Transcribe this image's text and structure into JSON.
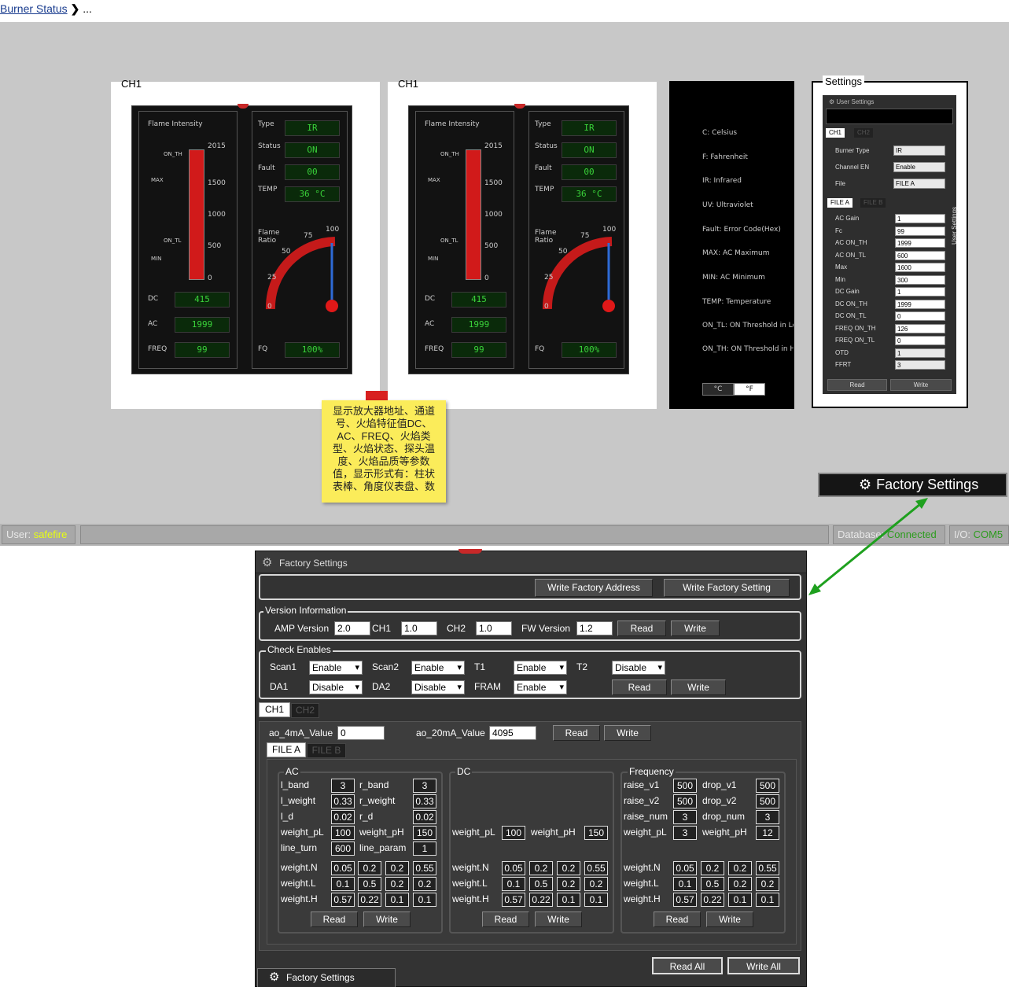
{
  "breadcrumb": {
    "link": "Burner Status",
    "separator": "❯",
    "ellipsis": "..."
  },
  "gauges": [
    {
      "title": "CH1",
      "flame_intensity_label": "Flame Intensity",
      "scale": [
        "2015",
        "1500",
        "1000",
        "500",
        "0"
      ],
      "markers": [
        "ON_TH",
        "MAX",
        "ON_TL",
        "MIN"
      ],
      "type_label": "Type",
      "type_value": "IR",
      "status_label": "Status",
      "status_value": "ON",
      "fault_label": "Fault",
      "fault_value": "00",
      "temp_label": "TEMP",
      "temp_value": "36 °C",
      "flame_ratio_label": "Flame Ratio",
      "ratio_ticks": [
        "0",
        "25",
        "50",
        "75",
        "100"
      ],
      "dc_label": "DC",
      "dc_value": "415",
      "ac_label": "AC",
      "ac_value": "1999",
      "freq_label": "FREQ",
      "freq_value": "99",
      "fq_label": "FQ",
      "fq_value": "100%"
    },
    {
      "title": "CH1",
      "flame_intensity_label": "Flame Intensity",
      "scale": [
        "2015",
        "1500",
        "1000",
        "500",
        "0"
      ],
      "markers": [
        "ON_TH",
        "MAX",
        "ON_TL",
        "MIN"
      ],
      "type_label": "Type",
      "type_value": "IR",
      "status_label": "Status",
      "status_value": "ON",
      "fault_label": "Fault",
      "fault_value": "00",
      "temp_label": "TEMP",
      "temp_value": "36 °C",
      "flame_ratio_label": "Flame Ratio",
      "ratio_ticks": [
        "0",
        "25",
        "50",
        "75",
        "100"
      ],
      "dc_label": "DC",
      "dc_value": "415",
      "ac_label": "AC",
      "ac_value": "1999",
      "freq_label": "FREQ",
      "freq_value": "99",
      "fq_label": "FQ",
      "fq_value": "100%"
    }
  ],
  "legend": {
    "items": [
      "C: Celsius",
      "F: Fahrenheit",
      "IR: Infrared",
      "UV: Ultraviolet",
      "Fault: Error Code(Hex)",
      "MAX: AC Maximum",
      "MIN: AC Minimum",
      "TEMP: Temperature",
      "ON_TL: ON Threshold in Low",
      "ON_TH: ON Threshold in High"
    ],
    "unit_c": "°C",
    "unit_f": "°F"
  },
  "settings_panel": {
    "title": "Settings",
    "header": "User Settings",
    "side_label": "User Settings",
    "tabs": [
      "CH1",
      "CH2"
    ],
    "burner_type_label": "Burner Type",
    "burner_type_value": "IR",
    "channel_en_label": "Channel EN",
    "channel_en_value": "Enable",
    "file_label": "File",
    "file_value": "FILE A",
    "file_tabs": [
      "FILE A",
      "FILE B"
    ],
    "rows": [
      {
        "label": "AC Gain",
        "value": "1"
      },
      {
        "label": "Fc",
        "value": "99"
      },
      {
        "label": "AC ON_TH",
        "value": "1999"
      },
      {
        "label": "AC ON_TL",
        "value": "600"
      },
      {
        "label": "Max",
        "value": "1600"
      },
      {
        "label": "Min",
        "value": "300"
      },
      {
        "label": "DC Gain",
        "value": "1"
      },
      {
        "label": "DC ON_TH",
        "value": "1999"
      },
      {
        "label": "DC ON_TL",
        "value": "0"
      },
      {
        "label": "FREQ ON_TH",
        "value": "126"
      },
      {
        "label": "FREQ ON_TL",
        "value": "0"
      },
      {
        "label": "OTD",
        "value": "1"
      },
      {
        "label": "FFRT",
        "value": "3"
      }
    ],
    "read": "Read",
    "write": "Write"
  },
  "note": {
    "text": "显示放大器地址、通道号、火焰特征值DC、AC、FREQ、火焰类型、火焰状态、探头温度、火焰品质等参数值，显示形式有：柱状表棒、角度仪表盘、数"
  },
  "factory_chip": {
    "label": "Factory Settings"
  },
  "status_bar": {
    "user_label": "User:",
    "user_value": "safefire",
    "db_label": "Database:",
    "db_value": "Connected",
    "io_label": "I/O:",
    "io_value": "COM5"
  },
  "factory": {
    "title": "Factory Settings",
    "write_address": "Write Factory Address",
    "write_setting": "Write Factory Setting",
    "version": {
      "legend": "Version Information",
      "amp_label": "AMP Version",
      "amp_value": "2.0",
      "ch1_label": "CH1",
      "ch1_value": "1.0",
      "ch2_label": "CH2",
      "ch2_value": "1.0",
      "fw_label": "FW Version",
      "fw_value": "1.2",
      "read": "Read",
      "write": "Write"
    },
    "checks": {
      "legend": "Check Enables",
      "scan1_label": "Scan1",
      "scan1_value": "Enable",
      "scan2_label": "Scan2",
      "scan2_value": "Enable",
      "t1_label": "T1",
      "t1_value": "Enable",
      "t2_label": "T2",
      "t2_value": "Disable",
      "da1_label": "DA1",
      "da1_value": "Disable",
      "da2_label": "DA2",
      "da2_value": "Disable",
      "fram_label": "FRAM",
      "fram_value": "Enable",
      "read": "Read",
      "write": "Write"
    },
    "ch_tabs": [
      "CH1",
      "CH2"
    ],
    "ao4_label": "ao_4mA_Value",
    "ao4_value": "0",
    "ao20_label": "ao_20mA_Value",
    "ao20_value": "4095",
    "ao_read": "Read",
    "ao_write": "Write",
    "file_tabs": [
      "FILE A",
      "FILE B"
    ],
    "ac": {
      "legend": "AC",
      "l_band_label": "l_band",
      "l_band": "3",
      "r_band_label": "r_band",
      "r_band": "3",
      "l_weight_label": "l_weight",
      "l_weight": "0.33",
      "r_weight_label": "r_weight",
      "r_weight": "0.33",
      "l_d_label": "l_d",
      "l_d": "0.02",
      "r_d_label": "r_d",
      "r_d": "0.02",
      "weight_pl_label": "weight_pL",
      "weight_pl": "100",
      "weight_ph_label": "weight_pH",
      "weight_ph": "150",
      "line_turn_label": "line_turn",
      "line_turn": "600",
      "line_param_label": "line_param",
      "line_param": "1",
      "wn_label": "weight.N",
      "wn": [
        "0.05",
        "0.2",
        "0.2",
        "0.55"
      ],
      "wl_label": "weight.L",
      "wl": [
        "0.1",
        "0.5",
        "0.2",
        "0.2"
      ],
      "wh_label": "weight.H",
      "wh": [
        "0.57",
        "0.22",
        "0.1",
        "0.1"
      ],
      "read": "Read",
      "write": "Write"
    },
    "dc": {
      "legend": "DC",
      "weight_pl_label": "weight_pL",
      "weight_pl": "100",
      "weight_ph_label": "weight_pH",
      "weight_ph": "150",
      "wn_label": "weight.N",
      "wn": [
        "0.05",
        "0.2",
        "0.2",
        "0.55"
      ],
      "wl_label": "weight.L",
      "wl": [
        "0.1",
        "0.5",
        "0.2",
        "0.2"
      ],
      "wh_label": "weight.H",
      "wh": [
        "0.57",
        "0.22",
        "0.1",
        "0.1"
      ],
      "read": "Read",
      "write": "Write"
    },
    "freq": {
      "legend": "Frequency",
      "raise_v1_label": "raise_v1",
      "raise_v1": "500",
      "drop_v1_label": "drop_v1",
      "drop_v1": "500",
      "raise_v2_label": "raise_v2",
      "raise_v2": "500",
      "drop_v2_label": "drop_v2",
      "drop_v2": "500",
      "raise_num_label": "raise_num",
      "raise_num": "3",
      "drop_num_label": "drop_num",
      "drop_num": "3",
      "weight_pl_label": "weight_pL",
      "weight_pl": "3",
      "weight_ph_label": "weight_pH",
      "weight_ph": "12",
      "wn_label": "weight.N",
      "wn": [
        "0.05",
        "0.2",
        "0.2",
        "0.55"
      ],
      "wl_label": "weight.L",
      "wl": [
        "0.1",
        "0.5",
        "0.2",
        "0.2"
      ],
      "wh_label": "weight.H",
      "wh": [
        "0.57",
        "0.22",
        "0.1",
        "0.1"
      ],
      "read": "Read",
      "write": "Write"
    },
    "read_all": "Read All",
    "write_all": "Write All",
    "bottom_tab": "Factory Settings"
  },
  "colors": {
    "accent_green": "#2d9c1e",
    "user_yellow": "#e8ff10",
    "arrow_green": "#1ea01e",
    "bar_red": "#d11a1a"
  }
}
